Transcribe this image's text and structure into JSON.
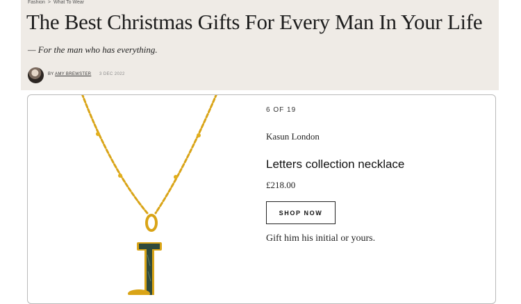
{
  "breadcrumb": {
    "items": [
      "Fashion",
      "What To Wear"
    ],
    "separator": ">"
  },
  "article": {
    "title": "The Best Christmas Gifts For Every Man In Your Life",
    "standfirst": "— For the man who has everything.",
    "by_label": "BY",
    "author": "AMY BREWSTER",
    "date": "3 DEC 2022"
  },
  "product": {
    "counter": "6 OF 19",
    "brand": "Kasun London",
    "name": "Letters collection necklace",
    "price": "£218.00",
    "cta_label": "SHOP NOW",
    "description": "Gift him his initial or yours.",
    "image_icon": "gold-letter-necklace-image"
  },
  "colors": {
    "header_bg": "#efebe6",
    "gold": "#d9a417",
    "enamel": "#2f4a3c"
  }
}
